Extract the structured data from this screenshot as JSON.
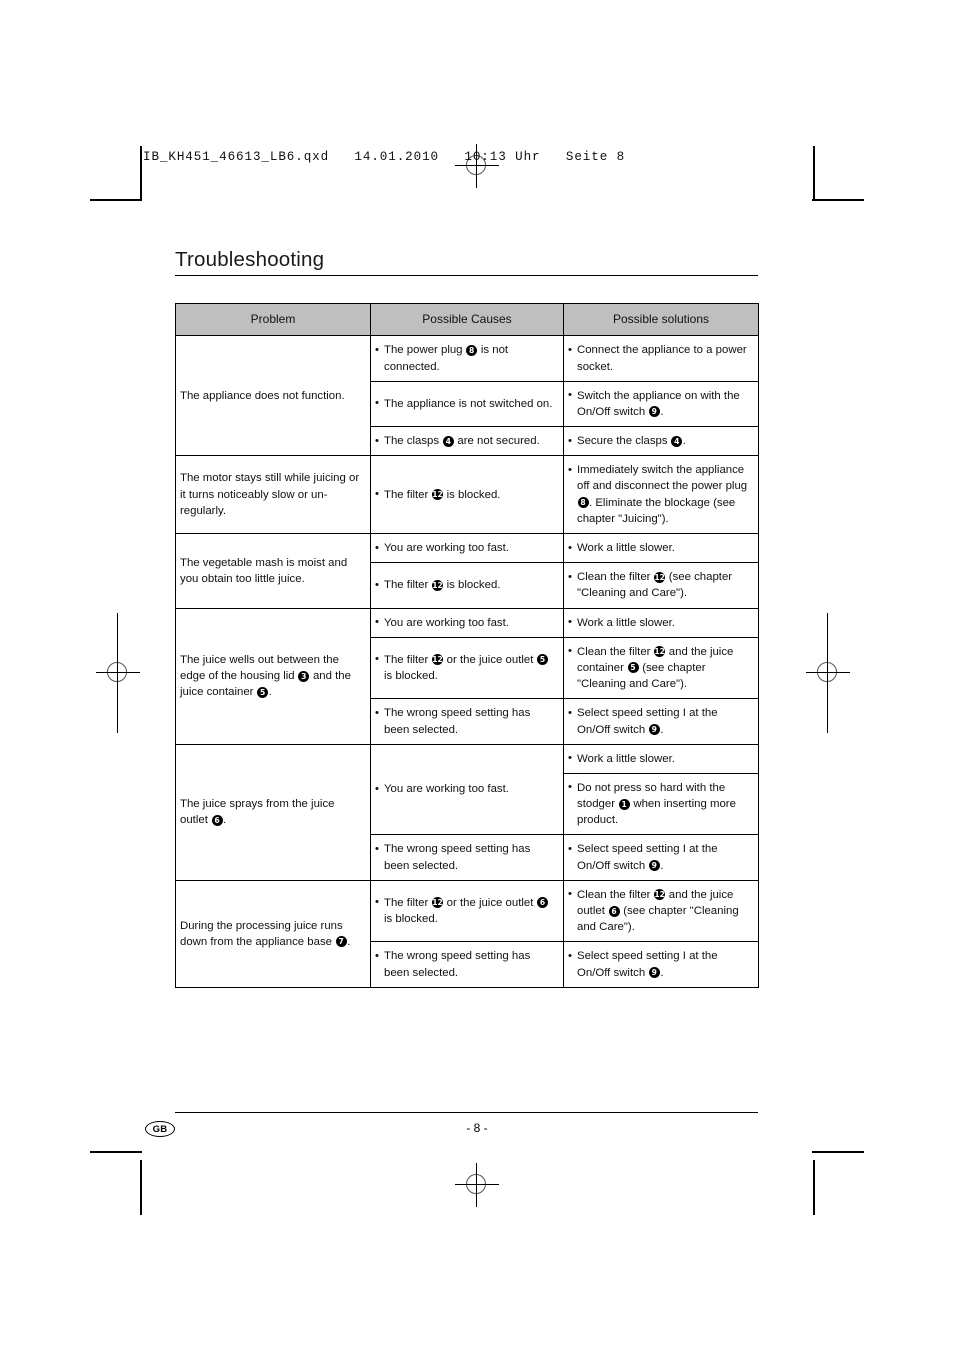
{
  "print_marks": {
    "file_header": "IB_KH451_46613_LB6.qxd   14.01.2010   10:13 Uhr   Seite 8"
  },
  "page": {
    "title": "Troubleshooting",
    "footer_locale_badge": "GB",
    "footer_page_number": "- 8 -"
  },
  "table": {
    "headers": {
      "problem": "Problem",
      "causes": "Possible Causes",
      "solutions": "Possible solutions"
    },
    "rows": [
      {
        "problem": "The appliance does not function.",
        "entries": [
          {
            "cause": "The power plug ➀ is not connected.",
            "solutions": [
              "Connect the appliance to a power socket."
            ]
          },
          {
            "cause": "The appliance is not switched on.",
            "solutions": [
              "Switch the appliance on with the On/Off switch ➁."
            ]
          },
          {
            "cause": "The clasps ➂ are not secured.",
            "solutions": [
              "Secure the clasps ➂."
            ]
          }
        ]
      },
      {
        "problem": "The motor stays still while juicing or it turns noticeably slow or un-regularly.",
        "entries": [
          {
            "cause": "The filter ➃ is blocked.",
            "solutions": [
              "Immediately switch the appliance off and disconnect the power plug ➀. Eliminate the blockage (see chapter \"Juicing\")."
            ]
          }
        ]
      },
      {
        "problem": "The vegetable mash is moist and you obtain too little juice.",
        "entries": [
          {
            "cause": "You are working too fast.",
            "solutions": [
              "Work a little slower."
            ]
          },
          {
            "cause": "The filter ➃ is blocked.",
            "solutions": [
              "Clean the filter ➃ (see chapter \"Cleaning and Care\")."
            ]
          }
        ]
      },
      {
        "problem": "The juice wells out between the edge of the housing lid ➄ and the juice container ➅.",
        "entries": [
          {
            "cause": "You are working too fast.",
            "solutions": [
              "Work a little slower."
            ]
          },
          {
            "cause": "The filter ➃ or the juice outlet ➅ is blocked.",
            "solutions": [
              "Clean the filter ➃ and the juice container ➅ (see chapter \"Cleaning and Care\")."
            ]
          },
          {
            "cause": "The wrong speed setting has been selected.",
            "solutions": [
              "Select speed setting I at the On/Off switch ➁."
            ]
          }
        ]
      },
      {
        "problem": "The juice sprays from the juice outlet ➆.",
        "entries": [
          {
            "cause": "You are working too fast.",
            "solutions": [
              "Work a little slower.",
              "Do not press so hard with the stodger ➇ when inserting more product."
            ]
          },
          {
            "cause": "The wrong speed setting has been selected.",
            "solutions": [
              "Select speed setting I at the On/Off switch ➁."
            ]
          }
        ]
      },
      {
        "problem": "During the processing juice runs down from the appliance base ➈.",
        "entries": [
          {
            "cause": "The filter ➃ or the juice outlet ➆ is blocked.",
            "solutions": [
              "Clean the filter ➃ and the juice outlet ➆ (see chapter \"Cleaning and Care\")."
            ]
          },
          {
            "cause": "The wrong speed setting has been selected.",
            "solutions": [
              "Select speed setting I at the On/Off switch ➁."
            ]
          }
        ]
      }
    ],
    "part_numbers": {
      "➀": "8",
      "➁": "9",
      "➂": "4",
      "➃": "12",
      "➄": "3",
      "➅": "5",
      "➆": "6",
      "➇": "1",
      "➈": "7"
    }
  }
}
